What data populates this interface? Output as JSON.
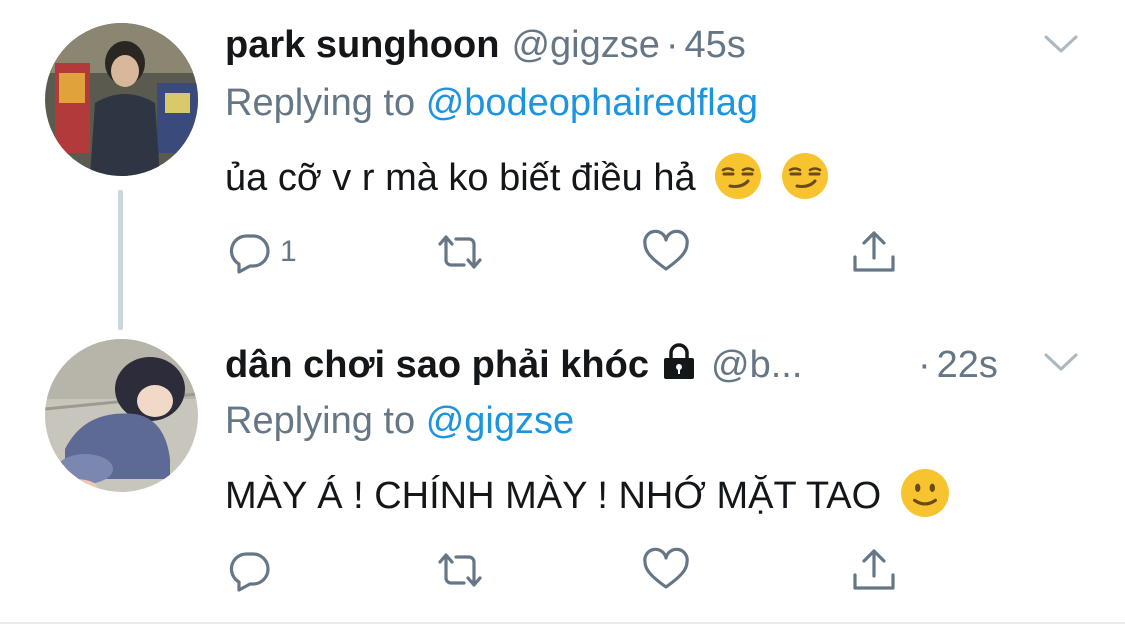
{
  "tweets": [
    {
      "name": "park sunghoon",
      "handle": "@gigzse",
      "dot": "·",
      "time": "45s",
      "replying_prefix": "Replying to",
      "replying_to": "@bodeophairedflag",
      "text": "ủa cỡ v r mà ko biết điều hả",
      "emojis": [
        "smirk-emoji",
        "smirk-emoji"
      ],
      "reply_count": "1",
      "protected": false
    },
    {
      "name": "dân chơi sao phải khóc",
      "handle": "@b...",
      "dot": "·",
      "time": "22s",
      "replying_prefix": "Replying to",
      "replying_to": "@gigzse",
      "text": "MÀY Á ! CHÍNH MÀY ! NHỚ MẶT TAO",
      "emojis": [
        "slight-smile-emoji"
      ],
      "reply_count": "",
      "protected": true
    }
  ],
  "colors": {
    "link": "#1b95e0",
    "secondary_text": "#657786",
    "primary_text": "#14171a",
    "thread_line": "#ccd6dd",
    "emoji_face": "#f7c42f"
  },
  "icons": {
    "reply": "reply-icon",
    "retweet": "retweet-icon",
    "like": "heart-icon",
    "share": "share-icon",
    "more": "chevron-down-icon",
    "lock": "lock-icon"
  }
}
